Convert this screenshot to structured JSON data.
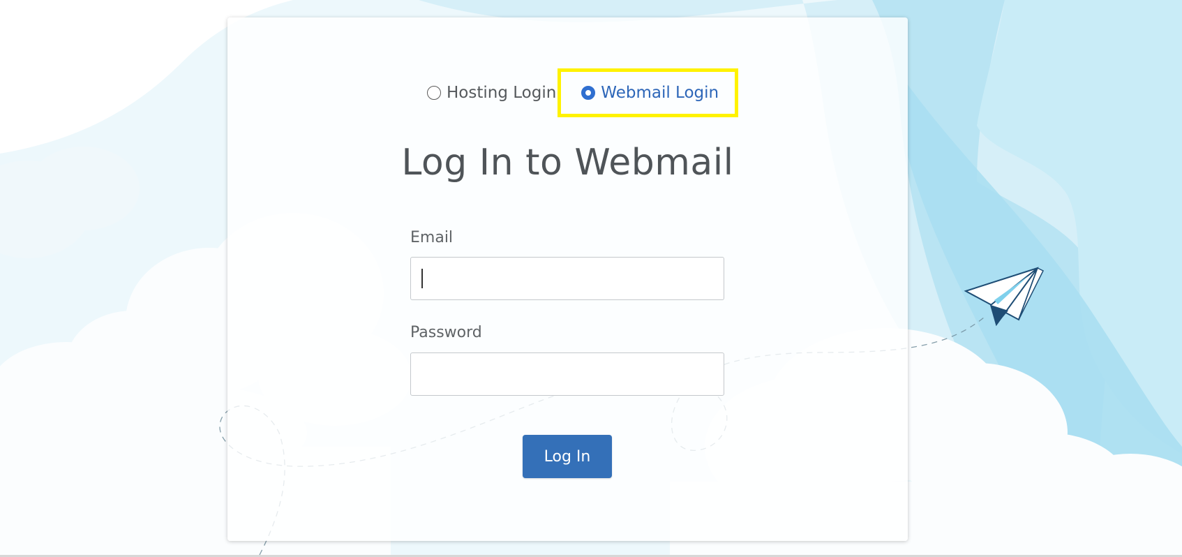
{
  "login_type": {
    "options": [
      {
        "label": "Hosting Login",
        "selected": false
      },
      {
        "label": "Webmail Login",
        "selected": true
      }
    ]
  },
  "page": {
    "title": "Log In to Webmail"
  },
  "form": {
    "email_label": "Email",
    "email_value": "",
    "password_label": "Password",
    "password_value": "",
    "submit_label": "Log In"
  },
  "colors": {
    "accent": "#3470b8",
    "selected_radio": "#2f6fd0",
    "highlight": "#fff200",
    "sky_light": "#e3f3fa",
    "sky_mid": "#b5e2f1",
    "sky_deep": "#9dd9ee"
  },
  "icons": {
    "background": "clouds-and-paper-plane"
  }
}
